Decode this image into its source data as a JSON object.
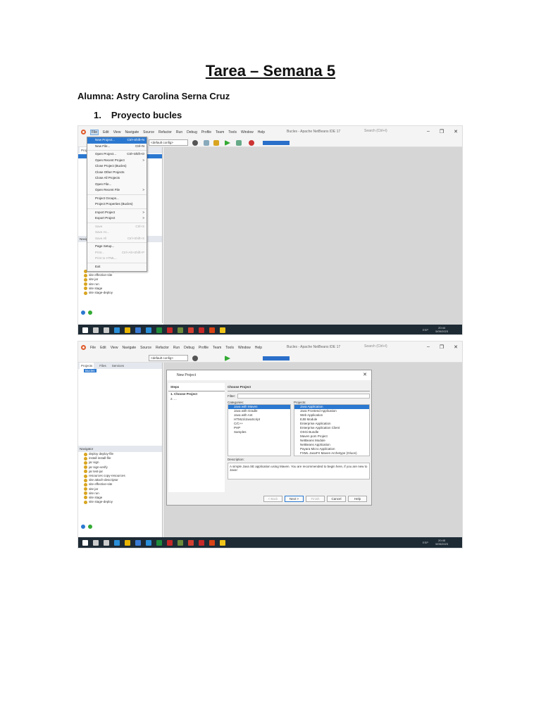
{
  "doc": {
    "title": "Tarea – Semana 5",
    "student": "Alumna: Astry Carolina Serna Cruz",
    "section_num": "1.",
    "section": "Proyecto bucles"
  },
  "ide": {
    "menus": [
      "File",
      "Edit",
      "View",
      "Navigate",
      "Source",
      "Refactor",
      "Run",
      "Debug",
      "Profile",
      "Team",
      "Tools",
      "Window",
      "Help"
    ],
    "window_title": "Bucles - Apache NetBeans IDE 17",
    "search_placeholder": "Search (Ctrl+I)",
    "config": "<default config>",
    "controls": [
      "–",
      "❐",
      "✕"
    ],
    "panel_tabs": [
      "Projects",
      "Files",
      "Services"
    ],
    "project": "Bucles",
    "navigator": "Navigator",
    "nav_items": [
      "deploy deploy-file",
      "install install-file",
      "jar sign",
      "jar sign-verify",
      "jar test-jar",
      "resources copy-resources",
      "site attach-descriptor",
      "site effective-site",
      "site jar",
      "site run",
      "site stage",
      "site stage-deploy"
    ]
  },
  "file_menu": [
    {
      "label": "New Project...",
      "shortcut": "Ctrl+Shift+N",
      "state": "selected"
    },
    {
      "label": "New File...",
      "shortcut": "Ctrl+N"
    },
    {
      "sep": true
    },
    {
      "label": "Open Project...",
      "shortcut": "Ctrl+Shift+O"
    },
    {
      "label": "Open Recent Project",
      "shortcut": ">"
    },
    {
      "label": "Close Project (Bucles)",
      "shortcut": ""
    },
    {
      "label": "Close Other Projects",
      "shortcut": ""
    },
    {
      "label": "Close All Projects",
      "shortcut": ""
    },
    {
      "label": "Open File...",
      "shortcut": ""
    },
    {
      "label": "Open Recent File",
      "shortcut": ">"
    },
    {
      "sep": true
    },
    {
      "label": "Project Groups...",
      "shortcut": ""
    },
    {
      "label": "Project Properties (Bucles)",
      "shortcut": ""
    },
    {
      "sep": true
    },
    {
      "label": "Import Project",
      "shortcut": ">"
    },
    {
      "label": "Export Project",
      "shortcut": ">"
    },
    {
      "sep": true
    },
    {
      "label": "Save",
      "shortcut": "Ctrl+S",
      "state": "disabled"
    },
    {
      "label": "Save As...",
      "shortcut": "",
      "state": "disabled"
    },
    {
      "label": "Save All",
      "shortcut": "Ctrl+Shift+S",
      "state": "disabled"
    },
    {
      "sep": true
    },
    {
      "label": "Page Setup...",
      "shortcut": ""
    },
    {
      "label": "Print...",
      "shortcut": "Ctrl+Alt+Shift+P",
      "state": "disabled"
    },
    {
      "label": "Print to HTML...",
      "shortcut": "",
      "state": "disabled"
    },
    {
      "sep": true
    },
    {
      "label": "Exit",
      "shortcut": ""
    }
  ],
  "dialog": {
    "title": "New Project",
    "steps_header": "Steps",
    "steps": [
      "1.  Choose Project",
      "2.  ..."
    ],
    "header": "Choose Project",
    "filter": "Filter:",
    "categories_label": "Categories:",
    "projects_label": "Projects:",
    "categories": [
      "Java with Maven",
      "Java with Gradle",
      "Java with Ant",
      "HTML5/JavaScript",
      "C/C++",
      "PHP",
      "Samples"
    ],
    "projects": [
      "Java Application",
      "Java Frontend Application",
      "Web Application",
      "EJB Module",
      "Enterprise Application",
      "Enterprise Application Client",
      "OSGi Bundle",
      "Maven pom Project",
      "NetBeans Module",
      "NetBeans Application",
      "Payara Micro Application",
      "FXML JavaFX Maven Archetype (Gluon)"
    ],
    "description_label": "Description:",
    "description": "A simple Java SE application using Maven. You are recommended to begin here, if you are new to Java!",
    "buttons": [
      "< Back",
      "Next >",
      "Finish",
      "Cancel",
      "Help"
    ]
  },
  "taskbar": [
    {
      "time": "20:44",
      "date": "5/05/2023",
      "lang": "ESP"
    },
    {
      "time": "20:45",
      "date": "5/05/2023",
      "lang": "ESP"
    }
  ],
  "taskbar_colors": [
    "#ffffff",
    "#cccccc",
    "#cccccc",
    "#2a8fd8",
    "#e8b400",
    "#3a7bd5",
    "#2a8fd8",
    "#1f8c3b",
    "#c62828",
    "#6d8b3a",
    "#d23f31",
    "#c62828",
    "#d84315",
    "#f0c419"
  ]
}
